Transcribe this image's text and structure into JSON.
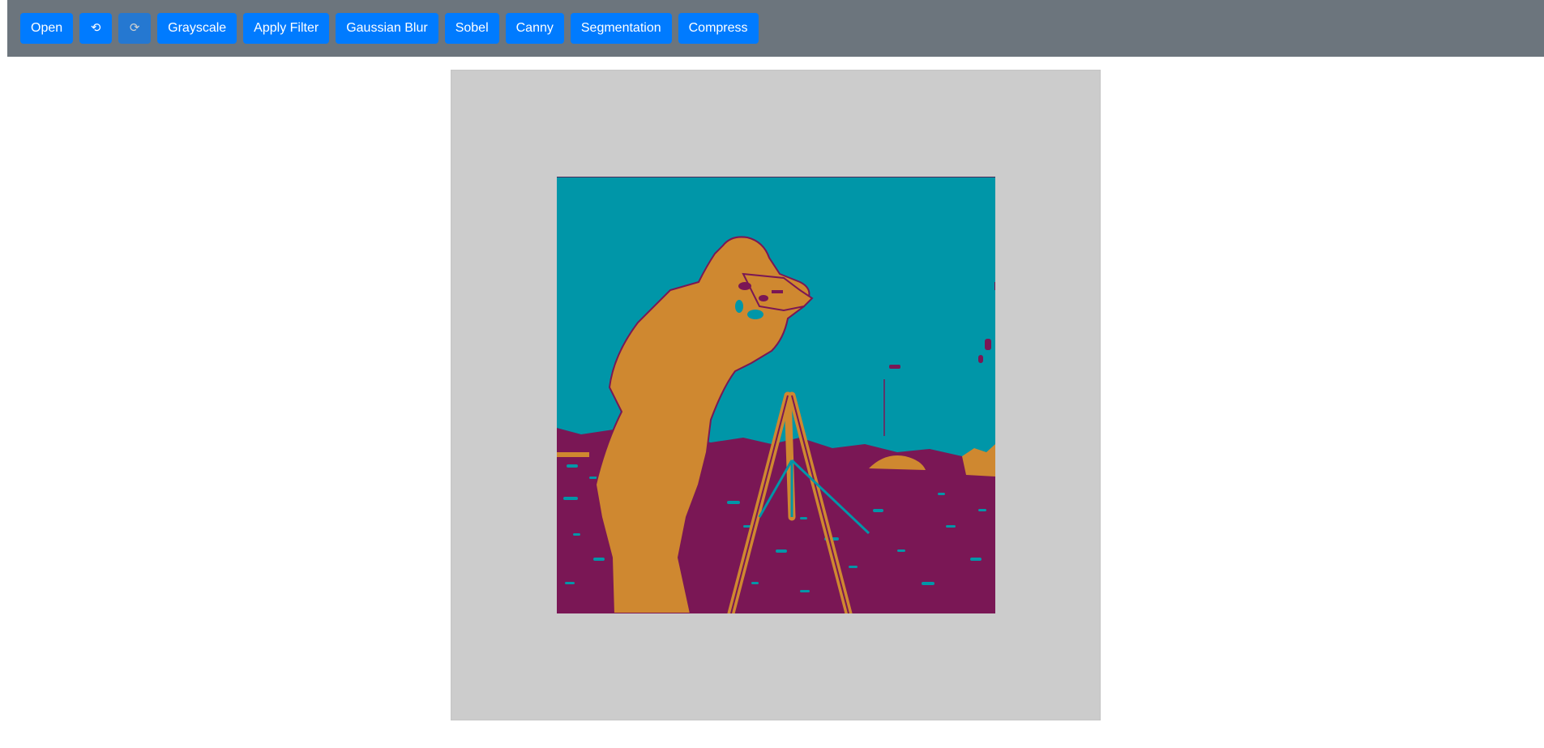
{
  "toolbar": {
    "open_label": "Open",
    "undo_glyph": "⟲",
    "redo_glyph": "⟳",
    "grayscale_label": "Grayscale",
    "apply_filter_label": "Apply Filter",
    "gaussian_blur_label": "Gaussian Blur",
    "sobel_label": "Sobel",
    "canny_label": "Canny",
    "segmentation_label": "Segmentation",
    "compress_label": "Compress",
    "redo_disabled": true
  },
  "canvas": {
    "image_description_icon": "segmented-photo-icon",
    "segment_colors": {
      "sky": "#0096a8",
      "figure": "#cf8830",
      "ground": "#7a1755"
    }
  },
  "colors": {
    "toolbar_bg": "#6c757d",
    "button_bg": "#007bff",
    "canvas_bg": "#cccccc"
  }
}
